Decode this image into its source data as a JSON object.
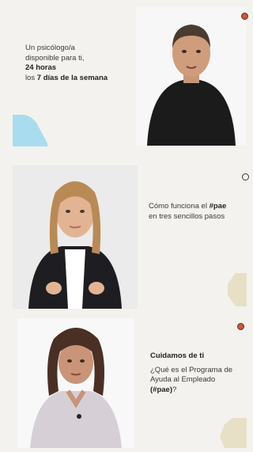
{
  "cards": [
    {
      "line1": "Un psicólogo/a",
      "line2": "disponible para ti,",
      "line3_bold": "24 horas",
      "line4_prefix": "los ",
      "line4_bold": "7 días de la semana"
    },
    {
      "line1_prefix": "Cómo funciona el ",
      "line1_bold": "#pae",
      "line2": "en tres sencillos pasos"
    },
    {
      "title": "Cuidamos de ti",
      "line1": "¿Qué es el Programa de",
      "line2": "Ayuda al Empleado",
      "line3_bold": "(#pae)",
      "line3_suffix": "?"
    }
  ],
  "colors": {
    "background": "#f3f2ee",
    "accent_blue": "#a9dcef",
    "accent_sand": "#e8dfc7",
    "accent_dot": "#d9532f"
  }
}
